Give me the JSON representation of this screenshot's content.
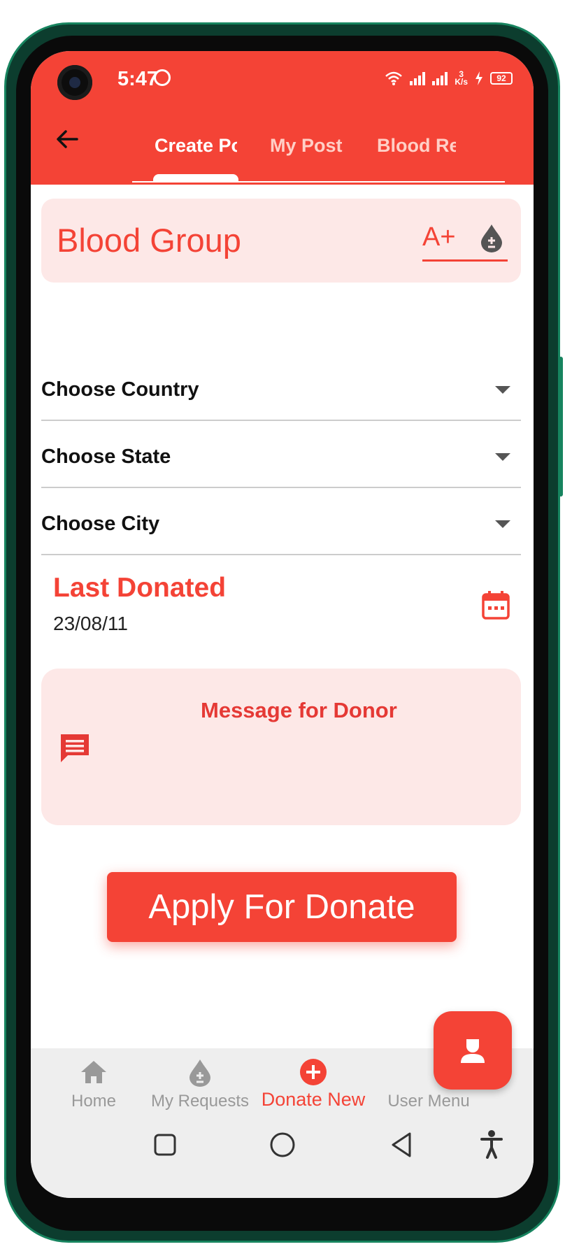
{
  "status_bar": {
    "time": "5:47",
    "network_speed_value": "3",
    "network_speed_unit": "K/s",
    "battery": "92"
  },
  "header": {
    "tabs": [
      {
        "label": "Create Post",
        "selected": true
      },
      {
        "label": "My Post",
        "selected": false
      },
      {
        "label": "Blood Requests",
        "selected": false
      }
    ]
  },
  "blood_group": {
    "label": "Blood Group",
    "value": "A+"
  },
  "dropdowns": {
    "country": "Choose Country",
    "state": "Choose State",
    "city": "Choose City"
  },
  "last_donated": {
    "label": "Last Donated",
    "date": "23/08/11"
  },
  "message": {
    "label": "Message for Donor"
  },
  "apply_button": {
    "label": "Apply For Donate"
  },
  "bottom_nav": {
    "items": [
      {
        "label": "Home",
        "icon": "home-icon"
      },
      {
        "label": "My Requests",
        "icon": "blood-drop-icon"
      },
      {
        "label": "Donate New",
        "icon": "add-circle-icon",
        "active": true
      },
      {
        "label": "User Menu",
        "icon": "user-icon"
      }
    ]
  },
  "colors": {
    "primary": "#f44336",
    "card_background": "#fde8e7",
    "nav_background": "#eeeeee"
  }
}
